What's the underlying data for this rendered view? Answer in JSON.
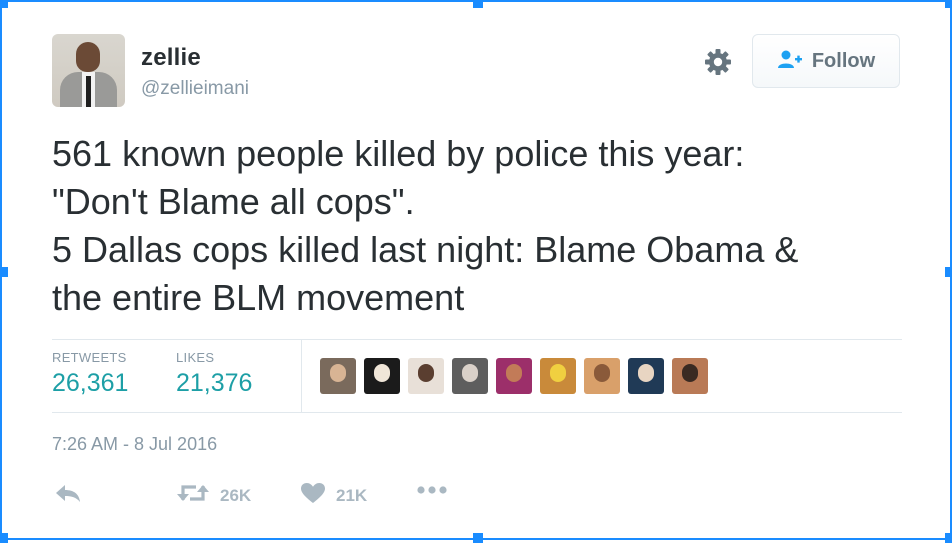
{
  "tweet": {
    "name": "zellie",
    "handle": "@zellieimani",
    "follow_label": "Follow",
    "text_lines": [
      "561 known people killed by police this year:",
      "\"Don't Blame all cops\".",
      "5 Dallas cops killed last night: Blame Obama &",
      "the entire BLM movement"
    ],
    "stats": {
      "retweets_label": "RETWEETS",
      "retweets_value": "26,361",
      "likes_label": "LIKES",
      "likes_value": "21,376"
    },
    "timestamp": "7:26 AM - 8 Jul 2016",
    "actions": {
      "retweet_count": "26K",
      "like_count": "21K"
    }
  },
  "icons": {
    "avatar": "avatar",
    "gear": "gear-icon",
    "follow": "add-user-icon",
    "reply": "reply-icon",
    "retweet": "retweet-icon",
    "like": "heart-icon",
    "more": "more-dots-icon"
  },
  "colors": {
    "selection": "#1a8cff",
    "stat_value": "#1d9fa6",
    "follow_icon": "#1da1f2",
    "text": "#292f33",
    "muted": "#8899a6",
    "action_icon": "#aab8c2"
  },
  "likers": [
    {
      "bg": "#7a6a5c",
      "face": "#d8b494"
    },
    {
      "bg": "#1b1b1b",
      "face": "#f0e6d8"
    },
    {
      "bg": "#e8e0d8",
      "face": "#5a3e30"
    },
    {
      "bg": "#5e5e5e",
      "face": "#d9d0c8"
    },
    {
      "bg": "#9c2f6a",
      "face": "#c27b58"
    },
    {
      "bg": "#c98a3a",
      "face": "#f0d040"
    },
    {
      "bg": "#d9a06a",
      "face": "#8a5a3a"
    },
    {
      "bg": "#203a56",
      "face": "#e8d5c2"
    },
    {
      "bg": "#b97a56",
      "face": "#3a2a22"
    }
  ]
}
